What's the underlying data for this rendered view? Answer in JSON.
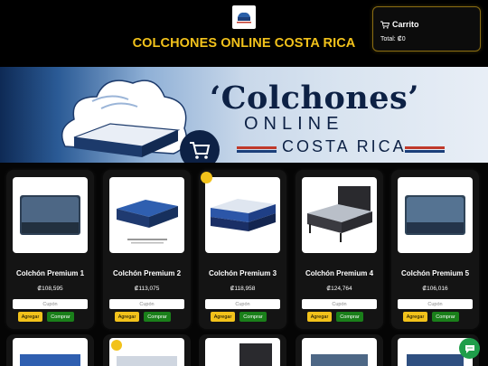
{
  "header": {
    "site_title": "COLCHONES ONLINE COSTA RICA",
    "logo_text": "COLCHONES ONLINE"
  },
  "cart": {
    "title": "Carrito",
    "total": "Total: ₡0"
  },
  "banner": {
    "line1": "‘Colchones’",
    "line2": "ONLINE",
    "line3": "COSTA RICA"
  },
  "products": [
    {
      "name": "Colchón Premium 1",
      "price": "₡108,595",
      "coupon_placeholder": "Cupón",
      "add_label": "Agregar",
      "buy_label": "Comprar",
      "badge": false
    },
    {
      "name": "Colchón Premium 2",
      "price": "₡113,075",
      "coupon_placeholder": "Cupón",
      "add_label": "Agregar",
      "buy_label": "Comprar",
      "badge": false
    },
    {
      "name": "Colchón Premium 3",
      "price": "₡118,958",
      "coupon_placeholder": "Cupón",
      "add_label": "Agregar",
      "buy_label": "Comprar",
      "badge": true
    },
    {
      "name": "Colchón Premium 4",
      "price": "₡124,764",
      "coupon_placeholder": "Cupón",
      "add_label": "Agregar",
      "buy_label": "Comprar",
      "badge": false
    },
    {
      "name": "Colchón Premium 5",
      "price": "₡106,016",
      "coupon_placeholder": "Cupón",
      "add_label": "Agregar",
      "buy_label": "Comprar",
      "badge": false
    }
  ],
  "colors": {
    "accent": "#f2c21b",
    "buy": "#1a7f1a",
    "chat": "#1f9e4a"
  },
  "icons": {
    "cart": "cart-icon",
    "chat": "chat-icon"
  }
}
